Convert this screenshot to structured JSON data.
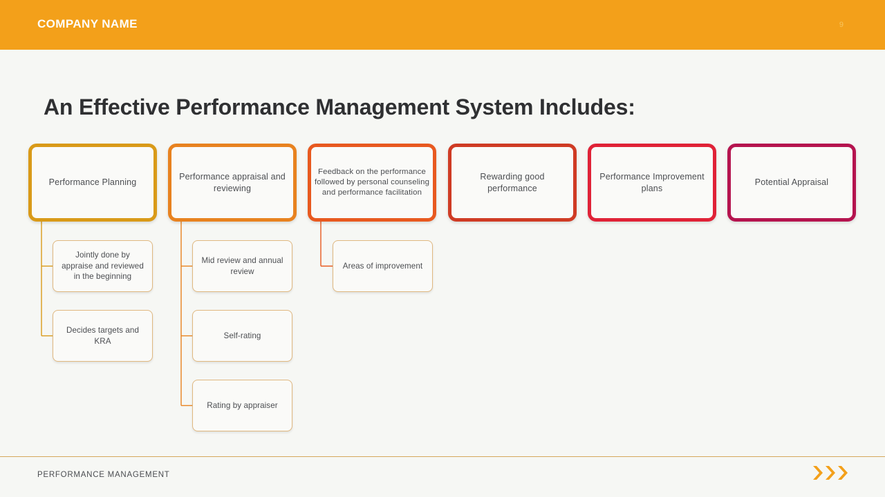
{
  "header": {
    "company_name": "COMPANY NAME",
    "page_number": "9",
    "band_color": "#f3a01a",
    "page_number_color": "#f7c55e"
  },
  "title": "An Effective Performance Management System Includes:",
  "diagram": {
    "top_boxes": [
      {
        "label": "Performance Planning",
        "border_color": "#d99a18",
        "accent_color": "#d99a18"
      },
      {
        "label": "Performance appraisal and reviewing",
        "border_color": "#e8821f",
        "accent_color": "#e8821f"
      },
      {
        "label": "Feedback on the performance followed by personal counseling and performance facilitation",
        "border_color": "#e8591f",
        "accent_color": "#e8591f"
      },
      {
        "label": "Rewarding good performance",
        "border_color": "#cf3b24",
        "accent_color": "#cf3b24"
      },
      {
        "label": "Performance Improvement plans",
        "border_color": "#e02237",
        "accent_color": "#e02237"
      },
      {
        "label": "Potential Appraisal",
        "border_color": "#b5144f",
        "accent_color": "#b5144f"
      }
    ],
    "sub_boxes": [
      {
        "parent": 0,
        "label": "Jointly done by appraise and reviewed in the beginning"
      },
      {
        "parent": 0,
        "label": "Decides targets and KRA"
      },
      {
        "parent": 1,
        "label": "Mid review and annual review"
      },
      {
        "parent": 1,
        "label": "Self-rating"
      },
      {
        "parent": 1,
        "label": "Rating by appraiser"
      },
      {
        "parent": 2,
        "label": "Areas of improvement"
      }
    ],
    "sub_box_border_color": "#e0b880",
    "connector_color": "#e09a3c"
  },
  "footer": {
    "label": "PERFORMANCE MANAGEMENT",
    "rule_color": "#d6a75c",
    "chevron_color": "#f3a01a",
    "chevron_count": 3
  }
}
